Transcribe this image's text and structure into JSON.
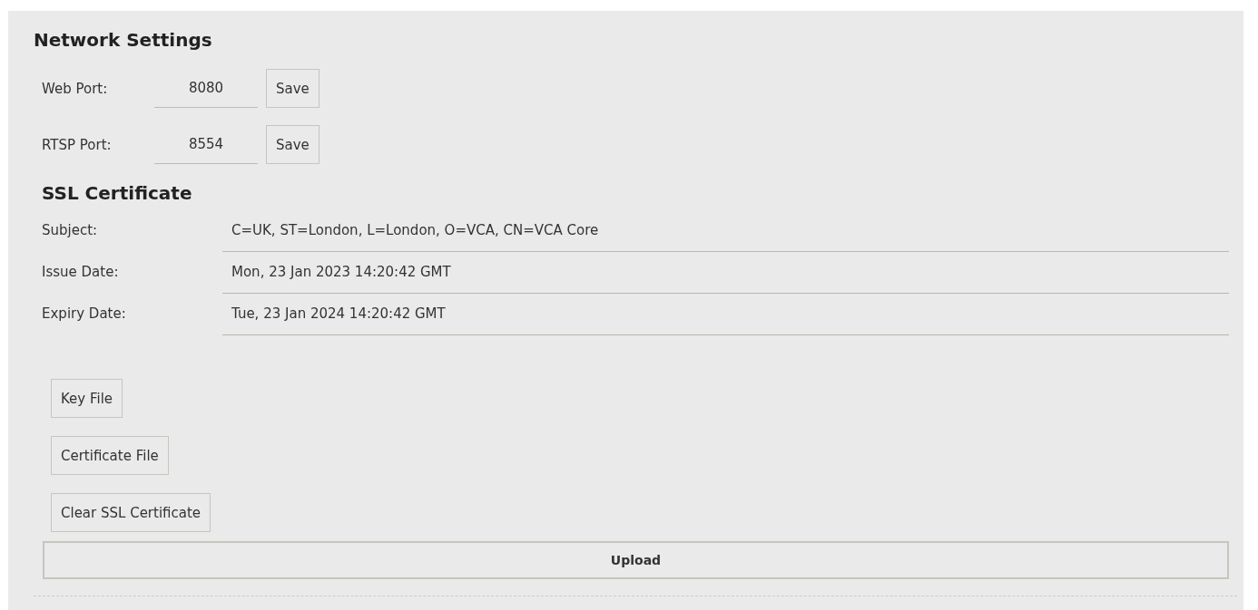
{
  "title": "Network Settings",
  "ports": [
    {
      "label": "Web Port:",
      "value": "8080",
      "button": "Save"
    },
    {
      "label": "RTSP Port:",
      "value": "8554",
      "button": "Save"
    }
  ],
  "ssl": {
    "title": "SSL Certificate",
    "fields": [
      {
        "label": "Subject:",
        "value": "C=UK, ST=London, L=London, O=VCA, CN=VCA Core"
      },
      {
        "label": "Issue Date:",
        "value": "Mon, 23 Jan 2023 14:20:42 GMT"
      },
      {
        "label": "Expiry Date:",
        "value": "Tue, 23 Jan 2024 14:20:42 GMT"
      }
    ],
    "buttons": [
      "Key File",
      "Certificate File",
      "Clear SSL Certificate"
    ],
    "upload": "Upload"
  }
}
